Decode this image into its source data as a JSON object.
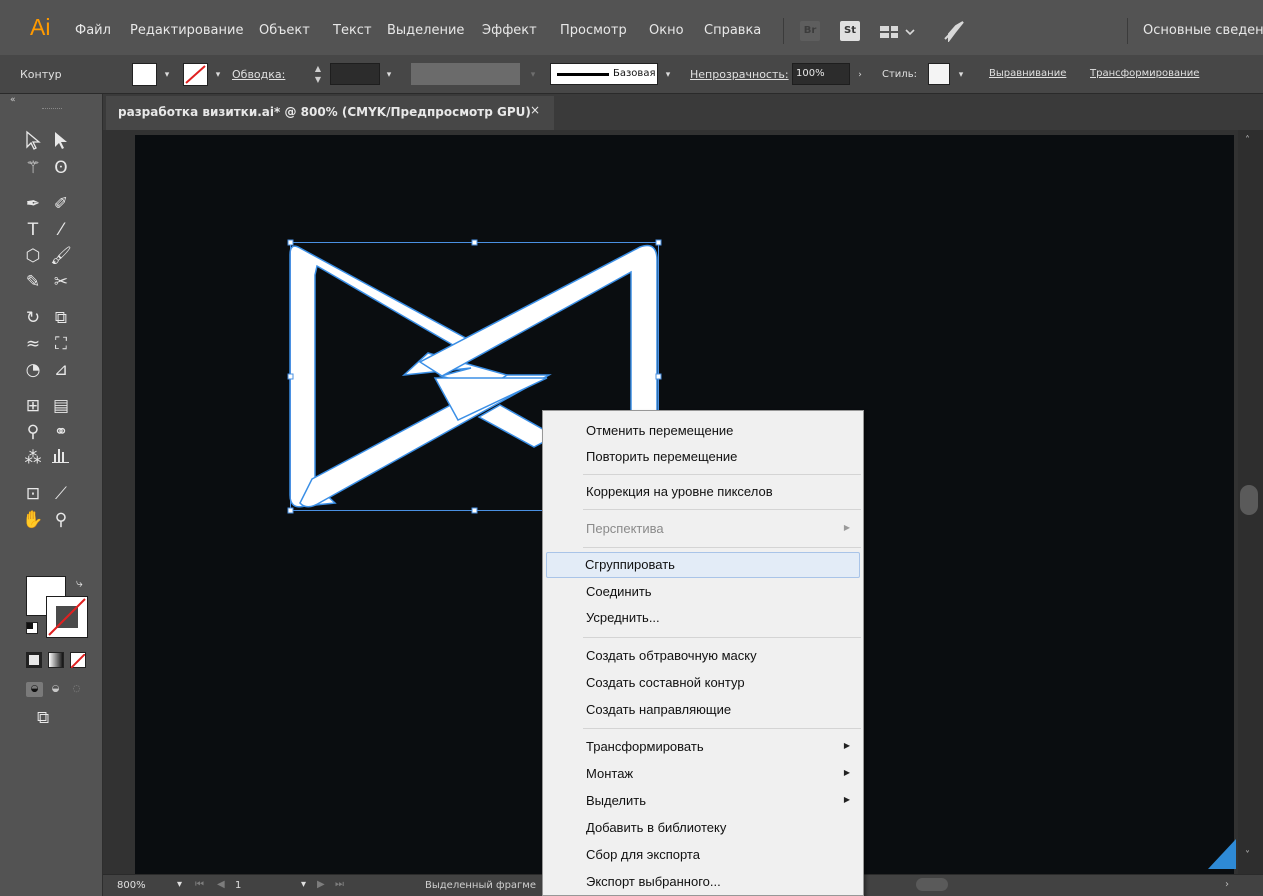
{
  "app": {
    "logo": "Ai",
    "workspace": "Основные сведен"
  },
  "menu": {
    "items": [
      "Файл",
      "Редактирование",
      "Объект",
      "Текст",
      "Выделение",
      "Эффект",
      "Просмотр",
      "Окно",
      "Справка"
    ],
    "bridge_label": "Br",
    "stock_label": "St"
  },
  "control_bar": {
    "selection_label": "Контур",
    "stroke_label": "Обводка:",
    "brush_label": "Базовая",
    "opacity_label": "Непрозрачность:",
    "opacity_value": "100%",
    "style_label": "Стиль:",
    "align_link": "Выравнивание",
    "transform_link": "Трансформирование"
  },
  "document": {
    "tab_title": "разработка визитки.ai* @ 800% (CMYK/Предпросмотр GPU)",
    "close_icon": "×"
  },
  "status_bar": {
    "zoom": "800%",
    "artboard_number": "1",
    "selection_info": "Выделенный фрагме"
  },
  "context_menu": {
    "items": [
      {
        "label": "Отменить перемещение",
        "enabled": true,
        "submenu": false
      },
      {
        "label": "Повторить перемещение",
        "enabled": true,
        "submenu": false
      },
      {
        "label": "Коррекция на уровне пикселов",
        "enabled": true,
        "submenu": false
      },
      {
        "label": "Перспектива",
        "enabled": false,
        "submenu": true
      },
      {
        "label": "Сгруппировать",
        "enabled": true,
        "submenu": false,
        "highlighted": true
      },
      {
        "label": "Соединить",
        "enabled": true,
        "submenu": false
      },
      {
        "label": "Усреднить...",
        "enabled": true,
        "submenu": false
      },
      {
        "label": "Создать обтравочную маску",
        "enabled": true,
        "submenu": false
      },
      {
        "label": "Создать составной контур",
        "enabled": true,
        "submenu": false
      },
      {
        "label": "Создать направляющие",
        "enabled": true,
        "submenu": false
      },
      {
        "label": "Трансформировать",
        "enabled": true,
        "submenu": true
      },
      {
        "label": "Монтаж",
        "enabled": true,
        "submenu": true
      },
      {
        "label": "Выделить",
        "enabled": true,
        "submenu": true
      },
      {
        "label": "Добавить в библиотеку",
        "enabled": true,
        "submenu": false
      },
      {
        "label": "Сбор для экспорта",
        "enabled": true,
        "submenu": false
      },
      {
        "label": "Экспорт выбранного...",
        "enabled": true,
        "submenu": false
      }
    ]
  },
  "colors": {
    "accent": "#2e8ad6",
    "artboard": "#0a0d10",
    "selection": "#4a90e2",
    "logo": "#ff9a00"
  }
}
